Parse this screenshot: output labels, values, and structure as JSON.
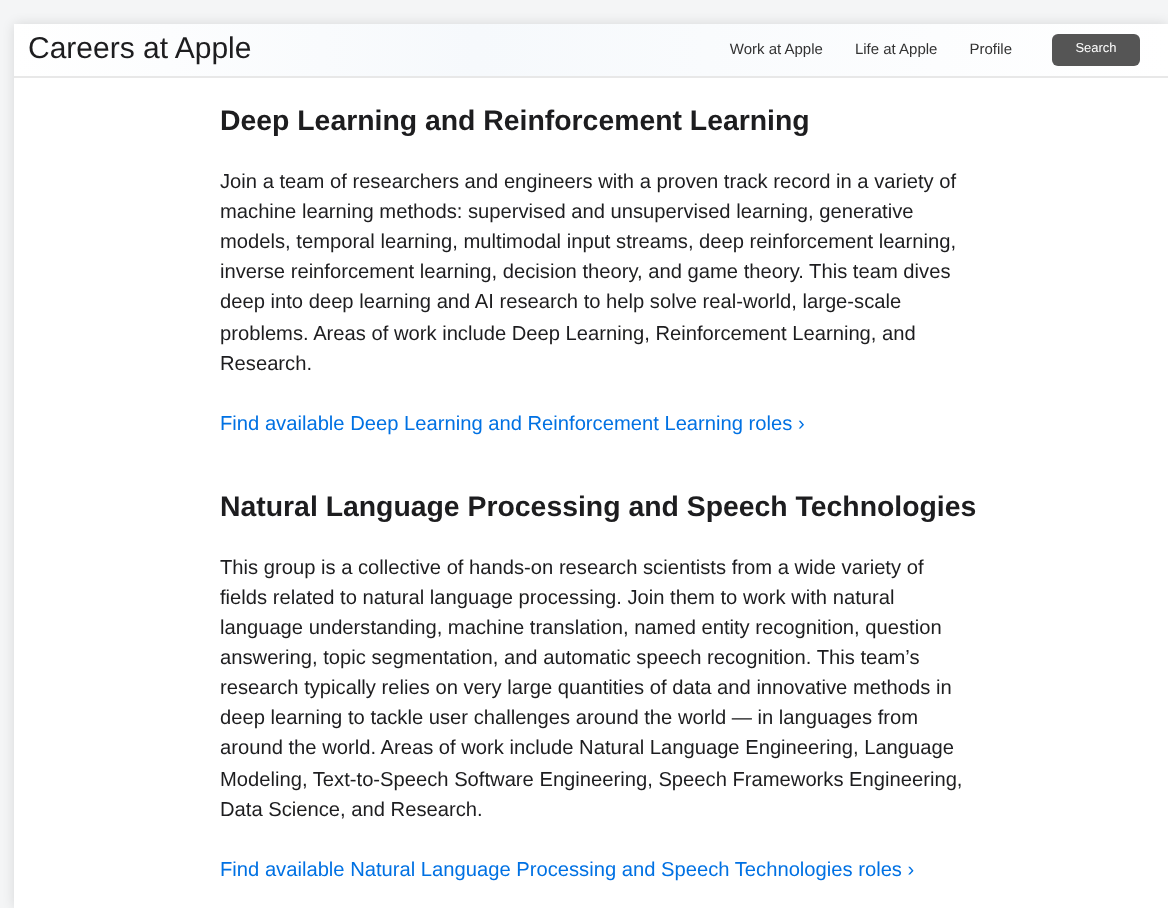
{
  "header": {
    "title": "Careers at Apple",
    "nav": [
      {
        "label": "Work at Apple"
      },
      {
        "label": "Life at Apple"
      },
      {
        "label": "Profile"
      }
    ],
    "search_button": "Search"
  },
  "sections": [
    {
      "heading": "Deep Learning and Reinforcement Learning",
      "body": "Join a team of researchers and engineers with a proven track record in a variety of machine learning methods: supervised and unsupervised learning, generative models, temporal learning, multimodal input streams, deep reinforcement learning, inverse reinforcement learning, decision theory, and game theory. This team dives deep into deep learning and AI research to help solve real-world, large-scale problems. Areas of work include Deep Learning, Reinforcement Learning, and Research.",
      "link": "Find available Deep Learning and Reinforcement Learning roles ›"
    },
    {
      "heading": "Natural Language Processing and Speech Technologies",
      "body": "This group is a collective of hands-on research scientists from a wide variety of fields related to natural language processing. Join them to work with natural language understanding, machine translation, named entity recognition, question answering, topic segmentation, and automatic speech recognition. This team’s research typically relies on very large quantities of data and innovative methods in deep learning to tackle user challenges around the world — in languages from around the world. Areas of work include Natural Language Engineering, Language Modeling, Text-to-Speech Software Engineering, Speech Frameworks Engineering, Data Science, and Research.",
      "link": "Find available Natural Language Processing and Speech Technologies roles ›"
    }
  ]
}
